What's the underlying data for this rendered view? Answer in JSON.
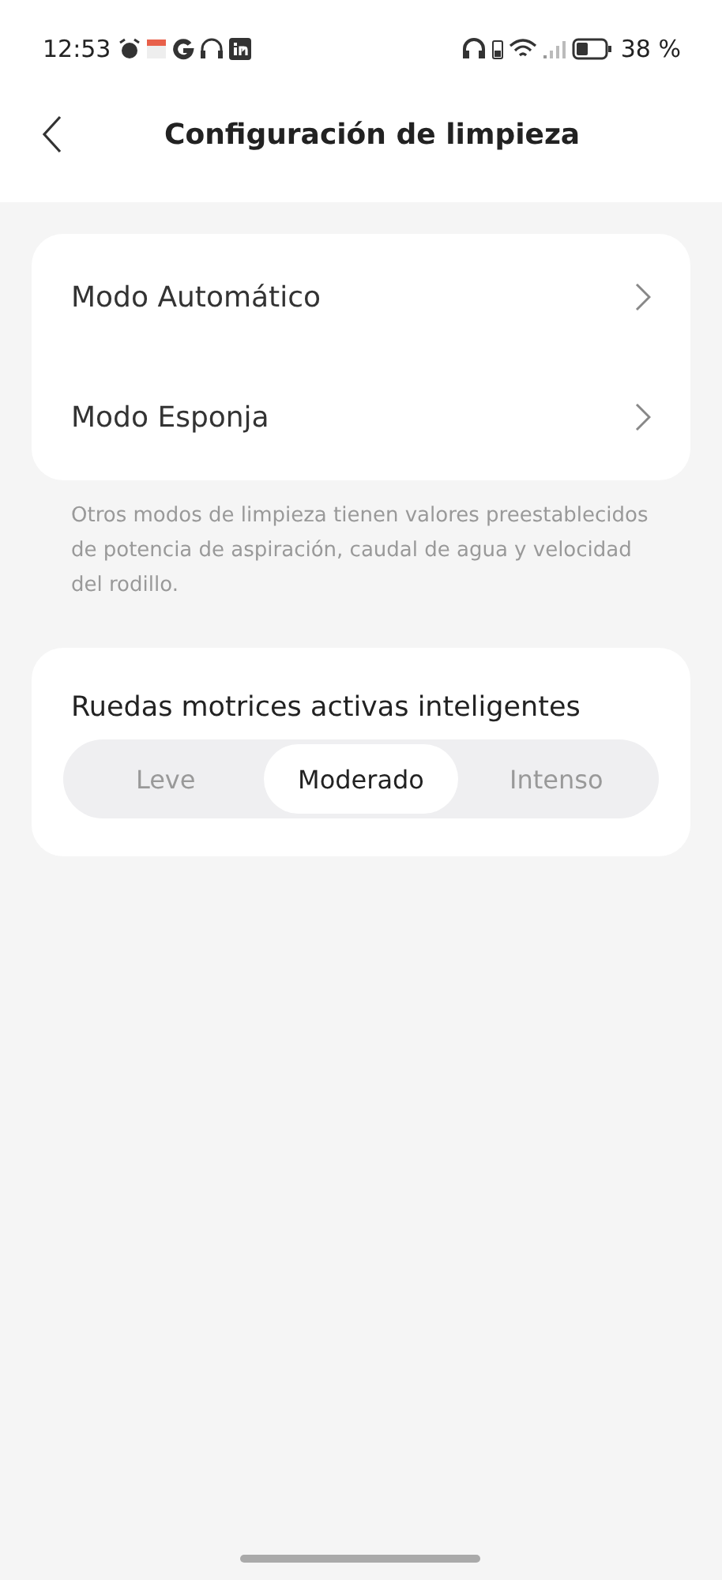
{
  "status_bar": {
    "time": "12:53",
    "battery": "38 %"
  },
  "header": {
    "title": "Configuración de limpieza"
  },
  "modes": [
    {
      "label": "Modo Automático"
    },
    {
      "label": "Modo Esponja"
    }
  ],
  "note": "Otros modos de limpieza tienen valores preestablecidos de potencia de aspiración, caudal de agua y velocidad del rodillo.",
  "wheels": {
    "title": "Ruedas motrices activas inteligentes",
    "options": [
      {
        "label": "Leve",
        "selected": false
      },
      {
        "label": "Moderado",
        "selected": true
      },
      {
        "label": "Intenso",
        "selected": false
      }
    ]
  }
}
